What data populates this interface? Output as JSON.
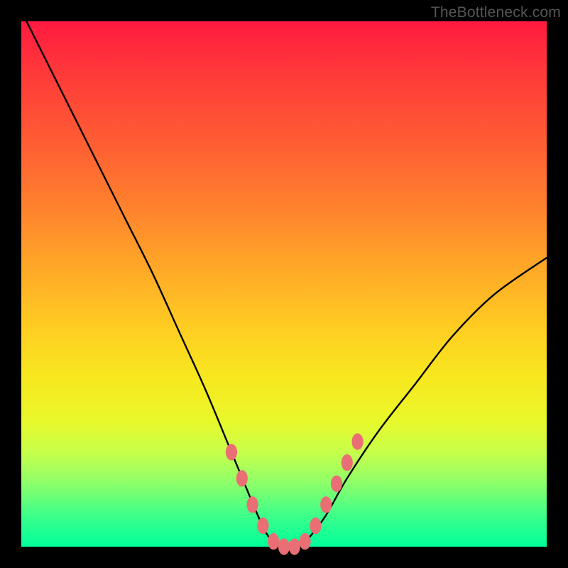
{
  "credit": "TheBottleneck.com",
  "chart_data": {
    "type": "line",
    "title": "",
    "xlabel": "",
    "ylabel": "",
    "xlim": [
      0,
      100
    ],
    "ylim": [
      0,
      100
    ],
    "series": [
      {
        "name": "curve",
        "x": [
          0,
          5,
          10,
          15,
          20,
          25,
          30,
          35,
          40,
          45,
          47,
          49,
          51,
          53,
          55,
          58,
          62,
          68,
          75,
          82,
          90,
          100
        ],
        "values": [
          102,
          92,
          82,
          72,
          62,
          52,
          41,
          30,
          18,
          6,
          2,
          0,
          0,
          0,
          2,
          6,
          13,
          22,
          31,
          40,
          48,
          55
        ]
      }
    ],
    "markers": {
      "name": "highlight-dots",
      "x": [
        40,
        42,
        44,
        46,
        48,
        50,
        52,
        54,
        56,
        58,
        60,
        62,
        64
      ],
      "values": [
        18,
        13,
        8,
        4,
        1,
        0,
        0,
        1,
        4,
        8,
        12,
        16,
        20
      ],
      "color": "#e96f75",
      "radius_px": 9
    },
    "background_gradient": {
      "top": "#ff1a3f",
      "mid_upper": "#ff7d2e",
      "mid_lower": "#ffe522",
      "bottom": "#00ff9a"
    }
  }
}
